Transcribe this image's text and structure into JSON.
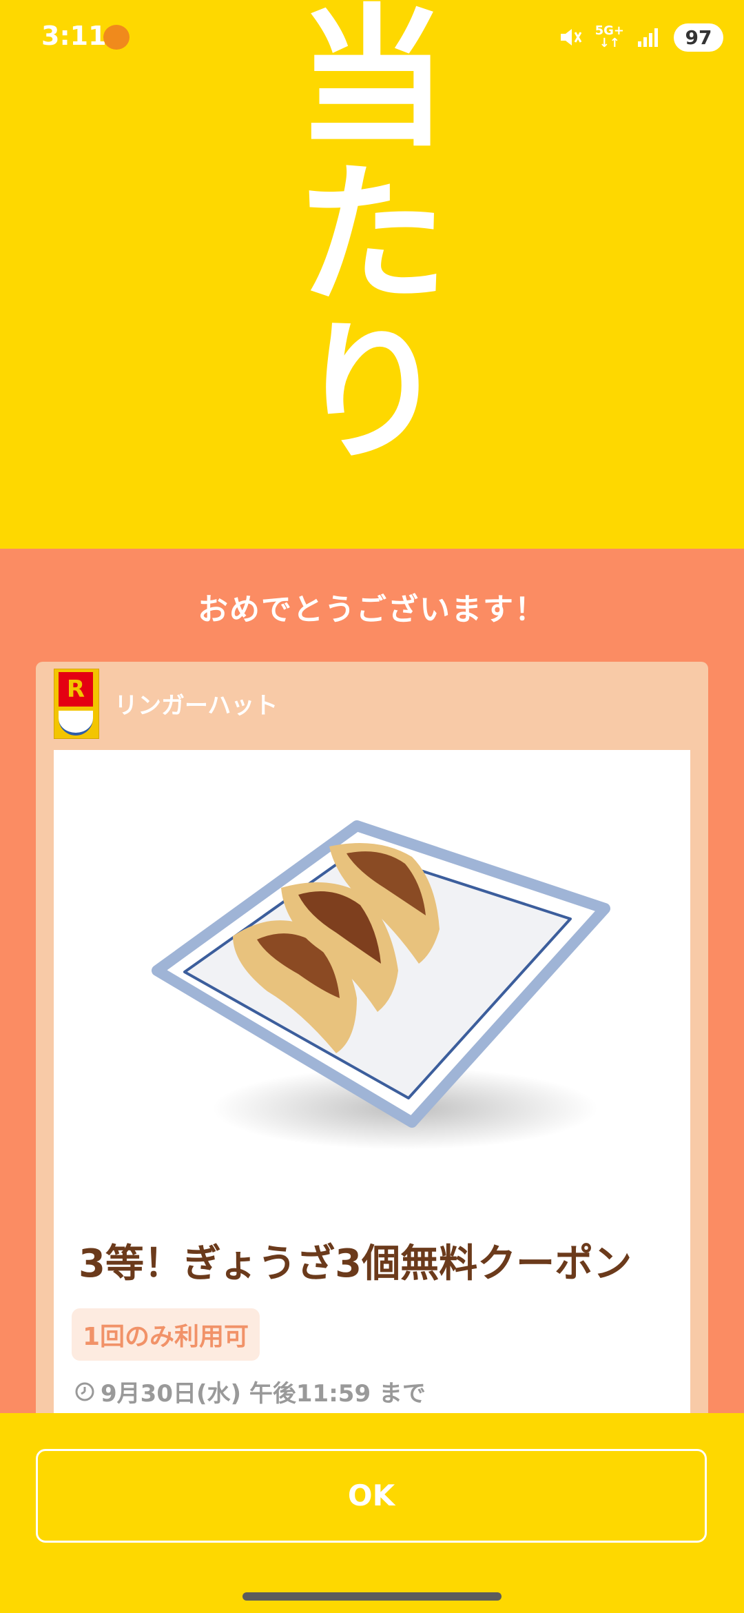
{
  "status_bar": {
    "time": "3:11",
    "network": "5G+",
    "battery": "97",
    "icons": [
      "app-notification-icon",
      "mute-icon",
      "signal-icon"
    ]
  },
  "hero": {
    "line1": "当",
    "line2": "た",
    "line3": "り"
  },
  "congrats_text": "おめでとうございます！",
  "coupon": {
    "brand_logo_text": "R",
    "brand_name": "リンガーハット",
    "title": "3等！ぎょうざ3個無料クーポン",
    "usage_badge": "1回のみ利用可",
    "expiry": "9月30日(水) 午後11:59 まで",
    "image": "gyoza-on-plate"
  },
  "actions": {
    "ok_label": "OK"
  },
  "colors": {
    "top_yellow": "#FED800",
    "mid_orange": "#FB8C63",
    "card_peach": "#F8CAA7",
    "title_brown": "#6B3A1B"
  }
}
